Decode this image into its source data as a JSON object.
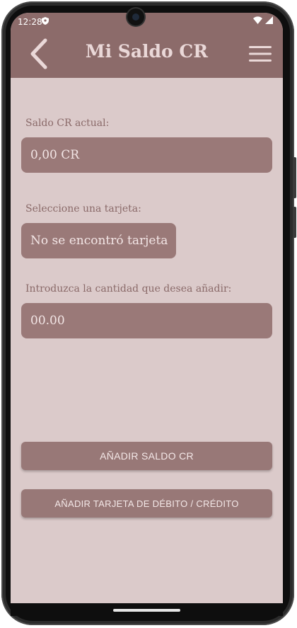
{
  "status_bar": {
    "time": "12:28",
    "shield_icon": "shield-icon",
    "wifi_icon": "wifi-icon",
    "signal_icon": "signal-icon"
  },
  "app_bar": {
    "title": "Mi Saldo CR",
    "back_icon": "chevron-left-icon",
    "menu_icon": "hamburger-menu-icon"
  },
  "balance": {
    "label": "Saldo CR actual:",
    "value": "0,00 CR"
  },
  "card": {
    "label": "Seleccione una tarjeta:",
    "selected": "No se encontró tarjeta"
  },
  "amount": {
    "label": "Introduzca la cantidad que desea añadir:",
    "placeholder": "00.00"
  },
  "actions": {
    "add_balance": "AÑADIR SALDO CR",
    "add_card": "AÑADIR TARJETA DE DÉBITO / CRÉDITO"
  },
  "colors": {
    "primary": "#8c6b6a",
    "field": "#9a7978",
    "background": "#dbcaca",
    "title_text": "#ead8d8"
  }
}
